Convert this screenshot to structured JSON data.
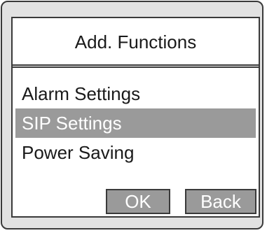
{
  "header": {
    "title": "Add. Functions"
  },
  "menu": {
    "items": [
      {
        "label": "Alarm Settings",
        "selected": false
      },
      {
        "label": "SIP Settings",
        "selected": true
      },
      {
        "label": "Power Saving",
        "selected": false
      }
    ]
  },
  "softkeys": {
    "ok_label": "OK",
    "back_label": "Back"
  },
  "colors": {
    "highlight": "#9a9a9a",
    "frame": "#3a3a3a",
    "bezel": "#e2e2e2"
  }
}
